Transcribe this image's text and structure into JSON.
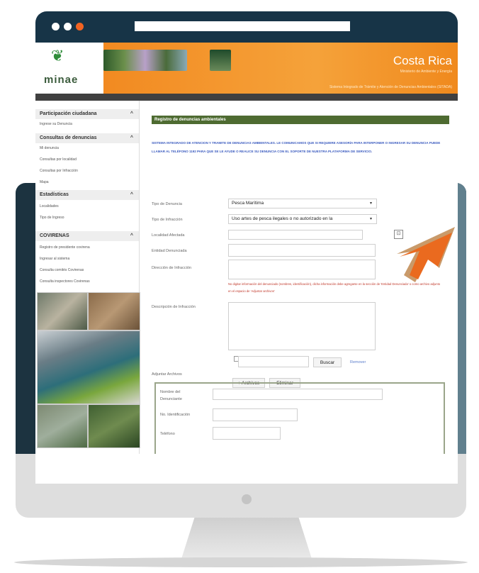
{
  "browser": {
    "dots": [
      "#ffffff",
      "#ffffff",
      "#f26322"
    ]
  },
  "site": {
    "logo": "minae",
    "country": "Costa Rica",
    "ministry": "Ministerio de Ambiente y Energía",
    "system": "Sistema Integrado de Trámite y Atención de Denuncias Ambientales (SITADA)",
    "colors": {
      "banner": "#f28a21",
      "section": "#4e6b31",
      "intro": "#3b5bbf",
      "warning": "#c0392b"
    }
  },
  "sidebar": {
    "sections": [
      {
        "title": "Participación ciudadana",
        "items": [
          "Ingrese su Denuncia"
        ]
      },
      {
        "title": "Consultas de denuncias",
        "items": [
          "Mi denuncia",
          "Consultas por localidad",
          "Consultas por Infracción",
          "Mapa"
        ]
      },
      {
        "title": "Estadísticas",
        "items": [
          "Localidades",
          "Tipo de Ingreso"
        ]
      },
      {
        "title": "COVIRENAS",
        "items": [
          "Registro de presidente covirena",
          "Ingresar al sistema",
          "Consulta comités Covirenas",
          "Consulta inspectores Covirenas"
        ]
      }
    ]
  },
  "form": {
    "section_title": "Registro de denuncias ambientales",
    "intro": "SISTEMA INTEGRADO DE ATENCION Y TRAMITE DE DENUNCIAS AMBIENTALES. LE COMUNICAMOS QUE SI REQUIERE ASESORÍA PARA INTERPONER O INGRESAR SU DENUNCIA PUEDE LLAMAR AL TELÉFONO 1192 PARA QUE SE LE AYUDE O REALICE SU DENUNCIA CON EL SOPORTE DE NUESTRA PLATAFORMA DE SERVICIO.",
    "tipo_denuncia_label": "Tipo de Denuncia",
    "tipo_denuncia_value": "Pesca Marítima",
    "tipo_infraccion_label": "Tipo de Infracción",
    "tipo_infraccion_value": "Uso artes de pesca ilegales o no autorizado en la",
    "localidad_label": "Localidad Afectada",
    "entidad_label": "Entidad Denunciada",
    "direccion_label": "Dirección de Infracción",
    "warning": "No digitar información del denunciado (nombres, identificación), dicha información debe agregarse en la sección de 'Entidad Denunciada' o como archivo adjunto en el espacio de 'Adjuntar archivos'",
    "descripcion_label": "Descripción de Infracción",
    "adjuntar_label": "Adjuntar Archivos",
    "buscar_label": "Buscar",
    "remover_label": "Remover",
    "archivos_label": "+ Archivos",
    "eliminar_label": "Eliminar",
    "nombre_label": "Nombre del Denunciante",
    "identificacion_label": "No. Identificación",
    "telefono_label": "Teléfono"
  }
}
